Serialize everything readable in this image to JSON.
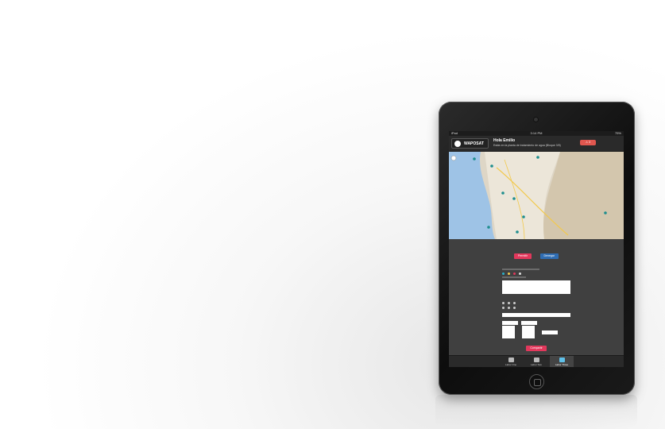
{
  "device": {
    "status_left": "iPad",
    "status_time": "3:14 PM",
    "status_right": "75%"
  },
  "app": {
    "logo_text": "WAPOSAT",
    "greeting": "Hola Emilio",
    "subline": "Estás en la planta de tratamiento de agua (Bloque 3/5)",
    "alert_label": "⚠ 3"
  },
  "map": {
    "pins": 9
  },
  "actions": {
    "primary_label": "Permitir",
    "secondary_label": "Denegar"
  },
  "form": {
    "share_label": "Compartir"
  },
  "tabs": [
    {
      "label": "Labor One"
    },
    {
      "label": "Labor Two"
    },
    {
      "label": "Labor Three"
    }
  ],
  "colors": {
    "accent_red": "#e2385c",
    "accent_blue": "#2f6db3",
    "screen_bg": "#404040"
  }
}
